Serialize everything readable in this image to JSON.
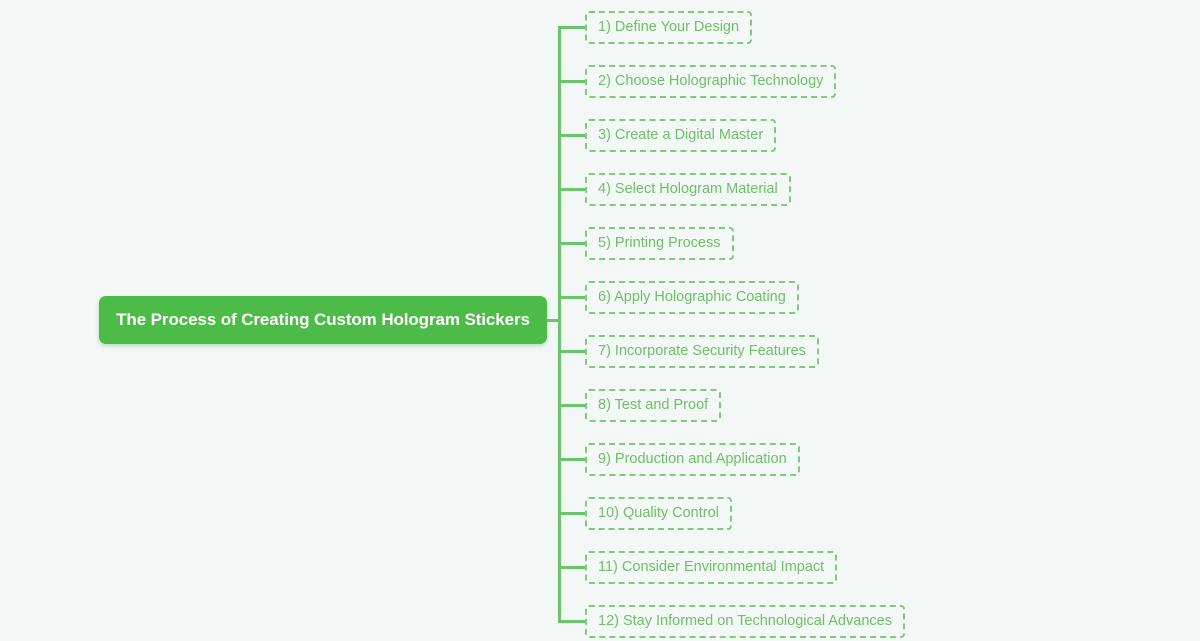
{
  "diagram": {
    "type": "mindmap",
    "orientation": "right",
    "background_color": "#f3f8f7",
    "accent_color": "#4cbb47",
    "branch_color": "#6dc067",
    "connector_color": "#6ac46a",
    "central": {
      "label": "The Process of Creating Custom Hologram Stickers"
    },
    "branches": [
      {
        "label": "1) Define Your Design"
      },
      {
        "label": "2) Choose Holographic Technology"
      },
      {
        "label": "3) Create a Digital Master"
      },
      {
        "label": "4) Select Hologram Material"
      },
      {
        "label": "5) Printing Process"
      },
      {
        "label": "6) Apply Holographic Coating"
      },
      {
        "label": "7) Incorporate Security Features"
      },
      {
        "label": "8) Test and Proof"
      },
      {
        "label": "9) Production and Application"
      },
      {
        "label": "10) Quality Control"
      },
      {
        "label": "11) Consider Environmental Impact"
      },
      {
        "label": "12) Stay Informed on Technological Advances"
      }
    ]
  }
}
